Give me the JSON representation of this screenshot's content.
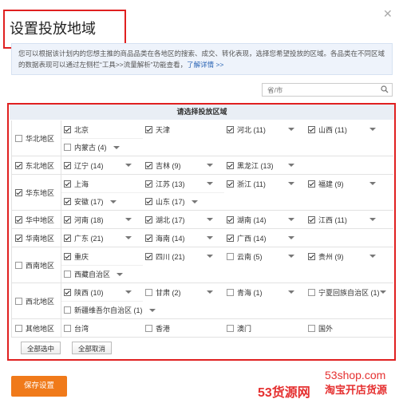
{
  "dialog": {
    "title": "设置投放地域",
    "info_text": "您可以根据该计划内的您想主推的商品品类在各地区的搜索、成交、转化表现，选择您希望投放的区域。各品类在不同区域的数据表现可以通过左侧栏“工具>>流量解析”功能查看，",
    "info_link": "了解详情 >>",
    "search_placeholder": "省/市"
  },
  "region_panel": {
    "header": "请选择投放区域",
    "rows": [
      {
        "region": "华北地区",
        "checked": false,
        "lines": [
          [
            {
              "n": "北京",
              "c": true,
              "d": false
            },
            {
              "n": "天津",
              "c": true,
              "d": false
            },
            {
              "n": "河北 (11)",
              "c": true,
              "d": true
            },
            {
              "n": "山西 (11)",
              "c": true,
              "d": true
            }
          ],
          [
            {
              "n": "内蒙古 (4)",
              "c": false,
              "d": true
            }
          ]
        ]
      },
      {
        "region": "东北地区",
        "checked": true,
        "lines": [
          [
            {
              "n": "辽宁 (14)",
              "c": true,
              "d": true
            },
            {
              "n": "吉林 (9)",
              "c": true,
              "d": true
            },
            {
              "n": "黑龙江 (13)",
              "c": true,
              "d": true
            }
          ]
        ]
      },
      {
        "region": "华东地区",
        "checked": true,
        "lines": [
          [
            {
              "n": "上海",
              "c": true,
              "d": false
            },
            {
              "n": "江苏 (13)",
              "c": true,
              "d": true
            },
            {
              "n": "浙江 (11)",
              "c": true,
              "d": true
            },
            {
              "n": "福建 (9)",
              "c": true,
              "d": true
            }
          ],
          [
            {
              "n": "安徽 (17)",
              "c": true,
              "d": true
            },
            {
              "n": "山东 (17)",
              "c": true,
              "d": true
            }
          ]
        ]
      },
      {
        "region": "华中地区",
        "checked": true,
        "lines": [
          [
            {
              "n": "河南 (18)",
              "c": true,
              "d": true
            },
            {
              "n": "湖北 (17)",
              "c": true,
              "d": true
            },
            {
              "n": "湖南 (14)",
              "c": true,
              "d": true
            },
            {
              "n": "江西 (11)",
              "c": true,
              "d": true
            }
          ]
        ]
      },
      {
        "region": "华南地区",
        "checked": true,
        "lines": [
          [
            {
              "n": "广东 (21)",
              "c": true,
              "d": true
            },
            {
              "n": "海南 (14)",
              "c": true,
              "d": true
            },
            {
              "n": "广西 (14)",
              "c": true,
              "d": true
            }
          ]
        ]
      },
      {
        "region": "西南地区",
        "checked": false,
        "lines": [
          [
            {
              "n": "重庆",
              "c": true,
              "d": false
            },
            {
              "n": "四川 (21)",
              "c": true,
              "d": true
            },
            {
              "n": "云南 (5)",
              "c": false,
              "d": true
            },
            {
              "n": "贵州 (9)",
              "c": true,
              "d": true
            }
          ],
          [
            {
              "n": "西藏自治区",
              "c": false,
              "d": true
            }
          ]
        ]
      },
      {
        "region": "西北地区",
        "checked": false,
        "lines": [
          [
            {
              "n": "陕西 (10)",
              "c": true,
              "d": true
            },
            {
              "n": "甘肃 (2)",
              "c": false,
              "d": true
            },
            {
              "n": "青海 (1)",
              "c": false,
              "d": true
            },
            {
              "n": "宁夏回族自治区 (1)",
              "c": false,
              "d": true
            }
          ],
          [
            {
              "n": "新疆维吾尔自治区 (1)",
              "c": false,
              "d": true
            }
          ]
        ]
      },
      {
        "region": "其他地区",
        "checked": false,
        "lines": [
          [
            {
              "n": "台湾",
              "c": false,
              "d": false
            },
            {
              "n": "香港",
              "c": false,
              "d": false
            },
            {
              "n": "澳门",
              "c": false,
              "d": false
            },
            {
              "n": "国外",
              "c": false,
              "d": false
            }
          ]
        ]
      }
    ],
    "select_all": "全部选中",
    "deselect_all": "全部取消"
  },
  "save_button": "保存设置",
  "watermark": {
    "url": "53shop.com",
    "brand": "53货源网",
    "slogan": "淘宝开店货源"
  }
}
